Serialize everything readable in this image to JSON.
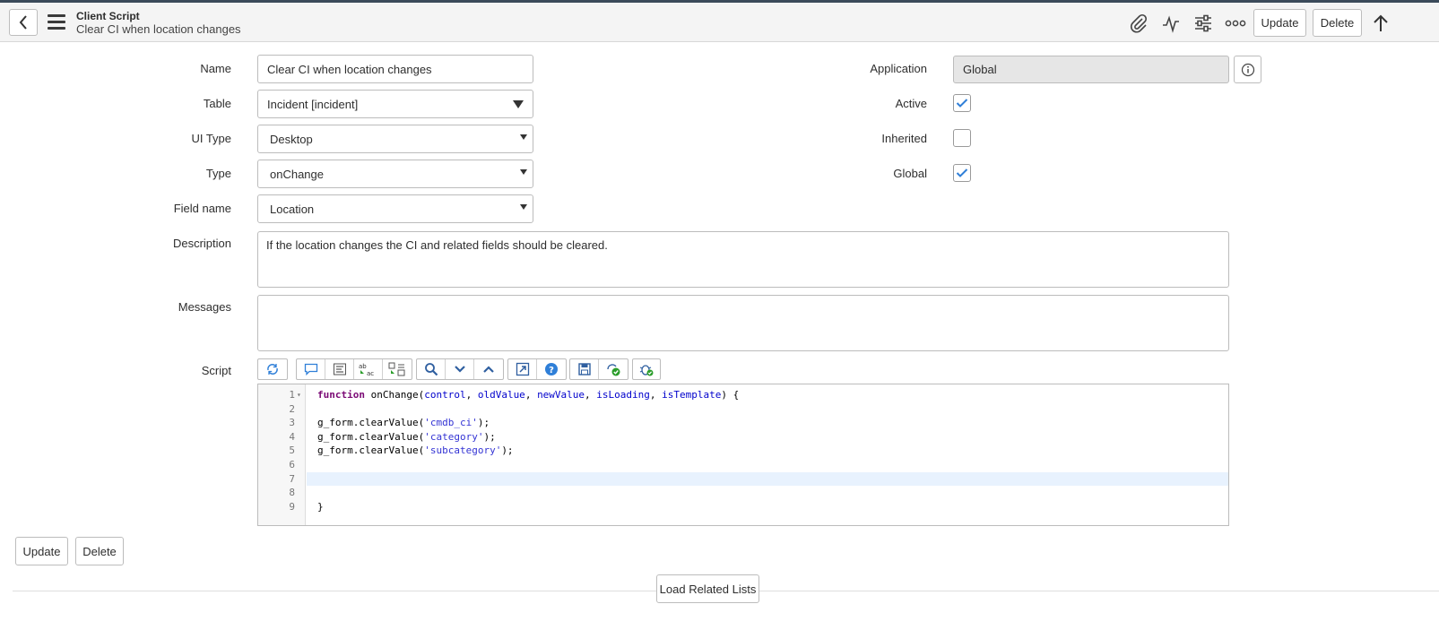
{
  "header": {
    "title": "Client Script",
    "subtitle": "Clear CI when location changes",
    "icons": [
      "back-icon",
      "menu-icon",
      "paperclip-icon",
      "activity-icon",
      "sliders-icon",
      "more-icon",
      "arrow-up-icon"
    ],
    "update_label": "Update",
    "delete_label": "Delete"
  },
  "form": {
    "name": {
      "label": "Name",
      "value": "Clear CI when location changes"
    },
    "table": {
      "label": "Table",
      "value": "Incident [incident]"
    },
    "ui_type": {
      "label": "UI Type",
      "value": "Desktop"
    },
    "type": {
      "label": "Type",
      "value": "onChange"
    },
    "field_name": {
      "label": "Field name",
      "value": "Location"
    },
    "description": {
      "label": "Description",
      "value": "If the location changes the CI and related fields should be cleared."
    },
    "messages": {
      "label": "Messages",
      "value": ""
    },
    "script": {
      "label": "Script"
    },
    "application": {
      "label": "Application",
      "value": "Global"
    },
    "active": {
      "label": "Active",
      "checked": true
    },
    "inherited": {
      "label": "Inherited",
      "checked": false
    },
    "global": {
      "label": "Global",
      "checked": true
    }
  },
  "script_toolbar": {
    "icons": [
      "toggle-syntax-icon",
      "comment-icon",
      "format-icon",
      "replace-icon",
      "replace-all-icon",
      "search-icon",
      "find-next-icon",
      "find-previous-icon",
      "fullscreen-icon",
      "help-icon",
      "save-icon",
      "check-syntax-icon",
      "debug-icon"
    ]
  },
  "editor": {
    "line_numbers": [
      "1",
      "2",
      "3",
      "4",
      "5",
      "6",
      "7",
      "8",
      "9"
    ],
    "lines": [
      "function onChange(control, oldValue, newValue, isLoading, isTemplate) {",
      "",
      "g_form.clearValue('cmdb_ci');",
      "g_form.clearValue('category');",
      "g_form.clearValue('subcategory');",
      "",
      "",
      "",
      "}"
    ],
    "active_line": 7
  },
  "footer": {
    "update_label": "Update",
    "delete_label": "Delete",
    "load_related_label": "Load Related Lists"
  },
  "colors": {
    "header_bg": "#f4f4f4",
    "accent": "#2f7fd8",
    "active_line": "#e8f2fe"
  }
}
